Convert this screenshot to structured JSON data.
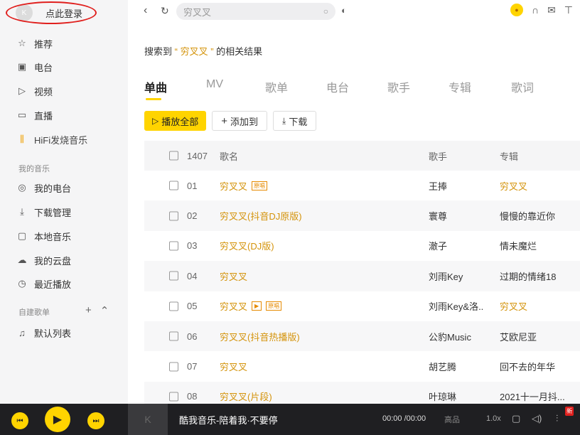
{
  "sidebar": {
    "login_label": "点此登录",
    "items": [
      {
        "icon": "star-icon",
        "label": "推荐"
      },
      {
        "icon": "radio-icon",
        "label": "电台"
      },
      {
        "icon": "video-icon",
        "label": "视频"
      },
      {
        "icon": "live-icon",
        "label": "直播"
      },
      {
        "icon": "hifi-icon",
        "label": "HiFi发烧音乐"
      }
    ],
    "my_music_label": "我的音乐",
    "my_items": [
      {
        "icon": "my-radio-icon",
        "label": "我的电台"
      },
      {
        "icon": "download-icon",
        "label": "下载管理"
      },
      {
        "icon": "local-music-icon",
        "label": "本地音乐"
      },
      {
        "icon": "cloud-icon",
        "label": "我的云盘"
      },
      {
        "icon": "history-icon",
        "label": "最近播放"
      }
    ],
    "playlists_label": "自建歌单",
    "default_list_label": "默认列表"
  },
  "topbar": {
    "search_placeholder": "穷叉叉"
  },
  "result": {
    "prefix": "搜索到",
    "keyword": "“ 穷叉叉 ”",
    "suffix": "的相关结果"
  },
  "tabs": [
    "单曲",
    "MV",
    "歌单",
    "电台",
    "歌手",
    "专辑",
    "歌词"
  ],
  "actions": {
    "play_all": "播放全部",
    "add_to": "添加到",
    "download": "下载"
  },
  "table": {
    "headers": {
      "count": "1407",
      "title": "歌名",
      "artist": "歌手",
      "album": "专辑"
    },
    "rows": [
      {
        "no": "01",
        "title": "穷叉叉",
        "tag": "原唱",
        "mv": "",
        "artist": "王捧",
        "album": "穷叉叉",
        "album_hl": true
      },
      {
        "no": "02",
        "title": "穷叉叉(抖音DJ原版)",
        "tag": "",
        "mv": "",
        "artist": "寰尊",
        "album": "慢慢的靠近你",
        "album_hl": false
      },
      {
        "no": "03",
        "title": "穷叉叉(DJ版)",
        "tag": "",
        "mv": "",
        "artist": "澈子",
        "album": "情未魔烂",
        "album_hl": false
      },
      {
        "no": "04",
        "title": "穷叉叉",
        "tag": "",
        "mv": "",
        "artist": "刘雨Key",
        "album": "过期的情绪18",
        "album_hl": false
      },
      {
        "no": "05",
        "title": "穷叉叉",
        "tag": "原唱",
        "mv": "▶",
        "artist": "刘雨Key&洛..",
        "album": "穷叉叉",
        "album_hl": true
      },
      {
        "no": "06",
        "title": "穷叉叉(抖音热播版)",
        "tag": "",
        "mv": "",
        "artist": "公豹Music",
        "album": "艾欧尼亚",
        "album_hl": false
      },
      {
        "no": "07",
        "title": "穷叉叉",
        "tag": "",
        "mv": "",
        "artist": "胡艺腾",
        "album": "回不去的年华",
        "album_hl": false
      },
      {
        "no": "08",
        "title": "穷叉叉(片段)",
        "tag": "",
        "mv": "",
        "artist": "叶琼琳",
        "album": "2021十一月抖...",
        "album_hl": false
      }
    ]
  },
  "player": {
    "song": "酷我音乐-陪着我·不要停",
    "time": "00:00 /00:00",
    "quality": "高品",
    "speed": "1.0x",
    "new_badge": "新"
  },
  "colors": {
    "accent": "#ffd400",
    "highlight": "#d4930a",
    "player_bg": "#1f1f22"
  }
}
